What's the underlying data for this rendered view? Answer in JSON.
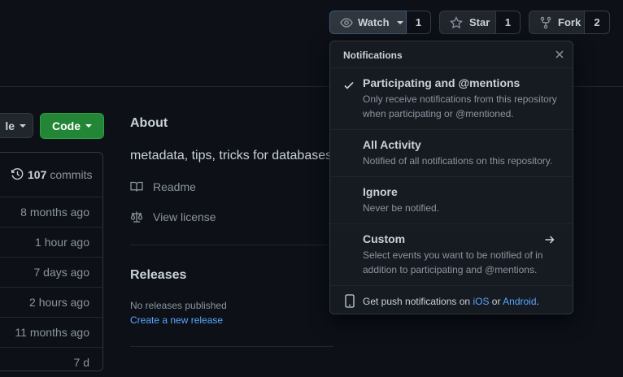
{
  "header": {
    "watch": {
      "label": "Watch",
      "count": "1"
    },
    "star": {
      "label": "Star",
      "count": "1"
    },
    "fork": {
      "label": "Fork",
      "count": "2"
    }
  },
  "left": {
    "truncated_button": "le",
    "code_button": "Code",
    "commits_count": "107",
    "commits_label": "commits",
    "times": [
      "8 months ago",
      "1 hour ago",
      "7 days ago",
      "2 hours ago",
      "11 months ago",
      "7 d"
    ]
  },
  "about": {
    "title": "About",
    "description": "metadata, tips, tricks for databases",
    "readme": "Readme",
    "license": "View license"
  },
  "releases": {
    "title": "Releases",
    "none_text": "No releases published",
    "create_link": "Create a new release"
  },
  "notifications": {
    "title": "Notifications",
    "options": [
      {
        "title": "Participating and @mentions",
        "desc": "Only receive notifications from this repository when participating or @mentioned.",
        "selected": true
      },
      {
        "title": "All Activity",
        "desc": "Notified of all notifications on this repository."
      },
      {
        "title": "Ignore",
        "desc": "Never be notified."
      },
      {
        "title": "Custom",
        "desc": "Select events you want to be notified of in addition to participating and @mentions."
      }
    ],
    "push": {
      "prefix": "Get push notifications on",
      "ios": "iOS",
      "or": "or",
      "android": "Android",
      "suffix": "."
    }
  },
  "colors": {
    "bg": "#0d1117",
    "green": "#238636",
    "link": "#58a6ff"
  }
}
